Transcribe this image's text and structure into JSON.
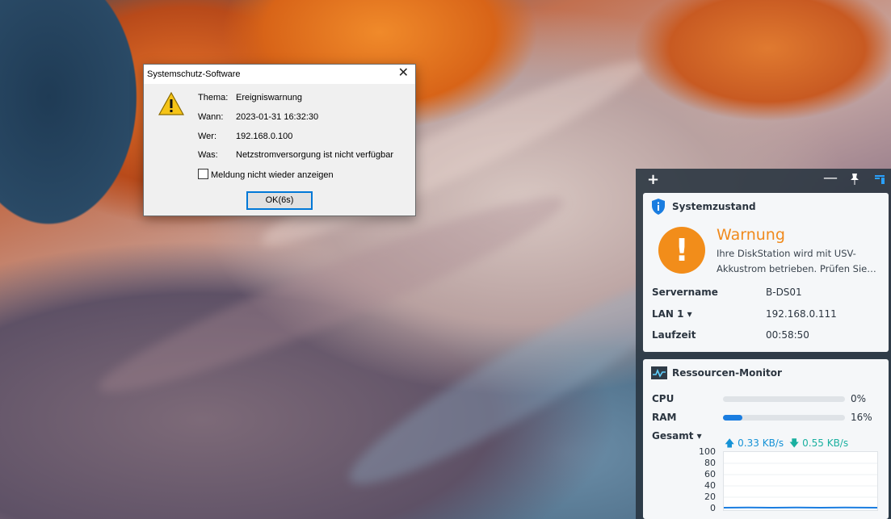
{
  "dialog": {
    "title": "Systemschutz-Software",
    "close_glyph": "✕",
    "rows": [
      {
        "key": "Thema:",
        "value": "Ereigniswarnung"
      },
      {
        "key": "Wann:",
        "value": "2023-01-31 16:32:30"
      },
      {
        "key": "Wer:",
        "value": "192.168.0.100"
      },
      {
        "key": "Was:",
        "value": "Netzstromversorgung ist nicht verfügbar"
      }
    ],
    "checkbox_label": "Meldung nicht wieder anzeigen",
    "checkbox_checked": false,
    "ok_label": "OK(6s)"
  },
  "panel": {
    "toolbar": {
      "add": "+",
      "minimize": "—",
      "pin": "📌"
    },
    "system": {
      "title": "Systemzustand",
      "status": "Warnung",
      "message": "Ihre DiskStation wird mit USV-Akkustrom betrieben. Prüfen Sie…",
      "rows": [
        {
          "key": "Servername",
          "value": "B-DS01"
        },
        {
          "key": "LAN 1 ▾",
          "value": "192.168.0.111"
        },
        {
          "key": "Laufzeit",
          "value": "00:58:50"
        }
      ]
    },
    "resource": {
      "title": "Ressourcen-Monitor",
      "cpu_label": "CPU",
      "cpu_pct": 0,
      "cpu_text": "0%",
      "ram_label": "RAM",
      "ram_pct": 16,
      "ram_text": "16%",
      "total_label": "Gesamt ▾",
      "upload": "0.33 KB/s",
      "download": "0.55 KB/s",
      "y_ticks": [
        "100",
        "80",
        "60",
        "40",
        "20",
        "0"
      ]
    }
  },
  "colors": {
    "warning": "#f28d1a",
    "accent": "#1a7de0",
    "net": "#1592d6"
  }
}
